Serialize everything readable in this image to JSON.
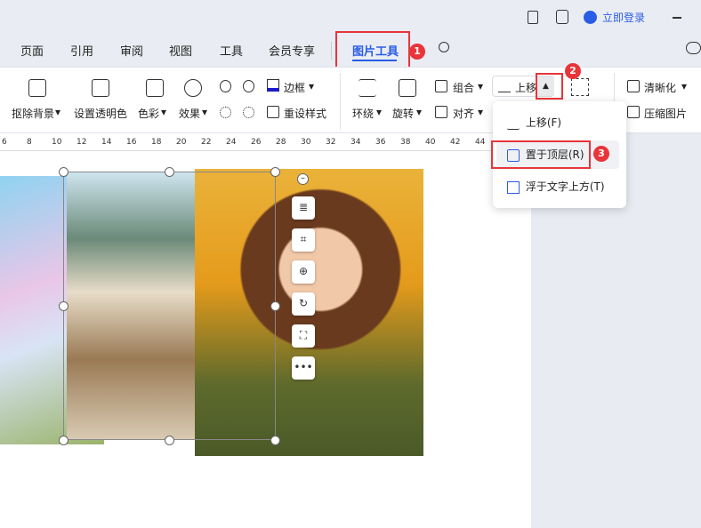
{
  "titlebar": {
    "login_label": "立即登录",
    "accent": "#2b5ce6"
  },
  "tabs": [
    {
      "label": "页面"
    },
    {
      "label": "引用"
    },
    {
      "label": "审阅"
    },
    {
      "label": "视图"
    },
    {
      "label": "工具"
    },
    {
      "label": "会员专享"
    },
    {
      "label": "图片工具",
      "active": true
    }
  ],
  "ribbon": {
    "remove_bg": "抠除背景",
    "set_transparent": "设置透明色",
    "color": "色彩",
    "effects": "效果",
    "border": "边框",
    "reset_style": "重设样式",
    "wrap": "环绕",
    "rotate": "旋转",
    "group": "组合",
    "align": "对齐",
    "bring_forward": "上移",
    "sharpen": "清晰化",
    "compress": "压缩图片"
  },
  "ruler": [
    "6",
    "8",
    "10",
    "12",
    "14",
    "16",
    "18",
    "20",
    "22",
    "24",
    "26",
    "28",
    "30",
    "32",
    "34",
    "36",
    "38",
    "40",
    "42",
    "44"
  ],
  "menu": {
    "items": [
      {
        "label": "上移(F)",
        "icon": "bring-forward-icon"
      },
      {
        "label": "置于顶层(R)",
        "icon": "bring-to-front-icon",
        "highlighted": true
      },
      {
        "label": "浮于文字上方(T)",
        "icon": "in-front-of-text-icon"
      }
    ]
  },
  "annotations": {
    "b1": "1",
    "b2": "2",
    "b3": "3",
    "color": "#e8343a"
  },
  "float_toolbar": [
    "wrap-icon",
    "crop-icon",
    "zoom-in-icon",
    "rotate-icon",
    "fit-icon",
    "more-icon"
  ],
  "more_label": "•••"
}
